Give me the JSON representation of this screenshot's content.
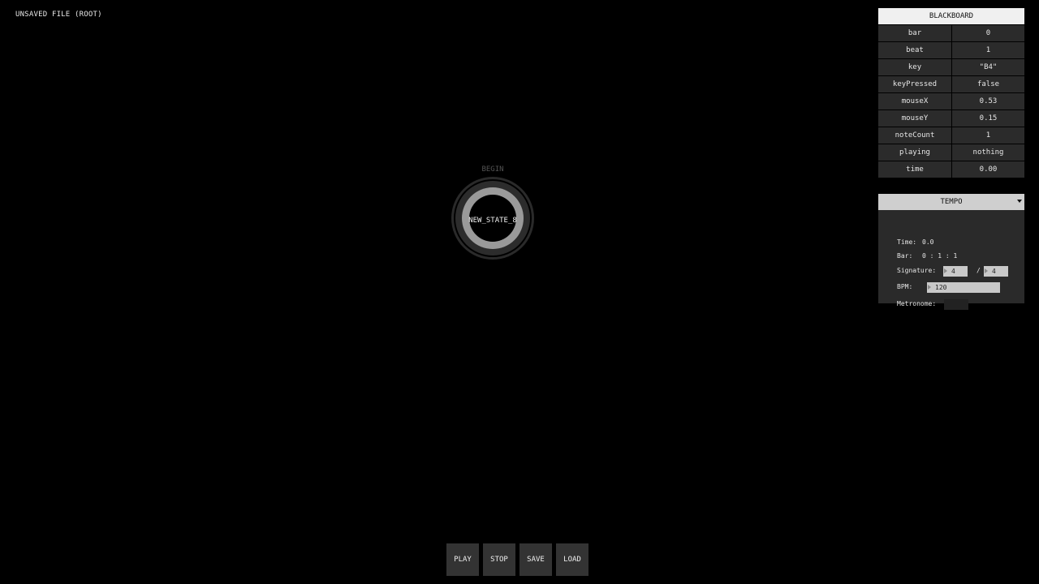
{
  "file": {
    "title": "UNSAVED FILE (ROOT)"
  },
  "state_machine": {
    "begin_label": "BEGIN",
    "state_name": "NEW_STATE_8"
  },
  "blackboard": {
    "title": "BLACKBOARD",
    "rows": [
      {
        "key": "bar",
        "value": "0"
      },
      {
        "key": "beat",
        "value": "1"
      },
      {
        "key": "key",
        "value": "\"B4\""
      },
      {
        "key": "keyPressed",
        "value": "false"
      },
      {
        "key": "mouseX",
        "value": "0.53"
      },
      {
        "key": "mouseY",
        "value": "0.15"
      },
      {
        "key": "noteCount",
        "value": "1"
      },
      {
        "key": "playing",
        "value": "nothing"
      },
      {
        "key": "time",
        "value": "0.00"
      }
    ]
  },
  "tempo": {
    "title": "TEMPO",
    "time_label": "Time:",
    "time_value": "0.0",
    "bar_label": "Bar:",
    "bar_value": "0 : 1 : 1",
    "signature_label": "Signature:",
    "signature_numerator": "4",
    "signature_separator": "/",
    "signature_denominator": "4",
    "bpm_label": "BPM:",
    "bpm_value": "120",
    "metronome_label": "Metronome:"
  },
  "transport": {
    "play": "PLAY",
    "stop": "STOP",
    "save": "SAVE",
    "load": "LOAD"
  }
}
